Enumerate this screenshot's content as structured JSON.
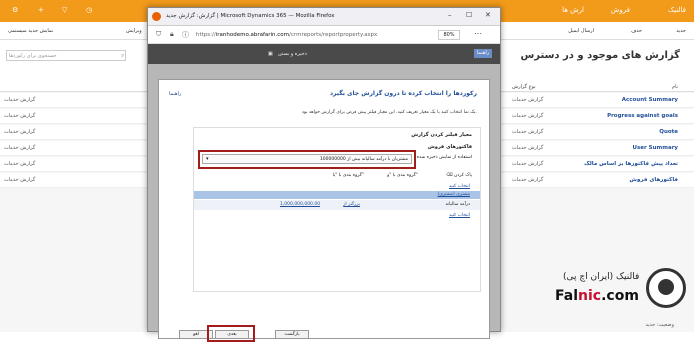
{
  "topbar": {
    "brand": "فالنیک",
    "sales": "فروش",
    "reports": "ارش ها"
  },
  "cmdbar": {
    "delete": "حذف",
    "send_email": "ارسال ایمیل",
    "new": "جدید",
    "edit": "ویرایش",
    "show_system": "نمایش جدید سیستمی"
  },
  "page": {
    "title": "گزارش های موجود و در دسترس",
    "search_placeholder": "جستجوی برای رکوردها"
  },
  "grid": {
    "col_name": "نام",
    "col_type": "نوع گزارش",
    "rows": [
      {
        "name": "Account Summary",
        "type": "گزارش خدمات"
      },
      {
        "name": "Progress against goals",
        "type": "گزارش خدمات"
      },
      {
        "name": "Quote",
        "type": "گزارش خدمات"
      },
      {
        "name": "User Summary",
        "type": "گزارش خدمات"
      },
      {
        "name": "تعداد پیش فاکتورها بر اساس مالک",
        "type": "گزارش خدمات"
      },
      {
        "name": "فاکتورهای فروش",
        "type": "گزارش خدمات"
      }
    ],
    "footer": "وضعیت: جدید"
  },
  "browser": {
    "title": "گزارش: گزارش جدید | Microsoft Dynamics 365 — Mozilla Firefox",
    "url_prefix": "https://",
    "url_domain": "iranhodemo.abrafarin.com",
    "url_path": "/crmreports/reportproperty.aspx",
    "zoom": "80%"
  },
  "crm_cmd": {
    "save_close": "ذخیره و بستن",
    "help": "راهنما"
  },
  "dialog": {
    "title": "رکوردها را انتخاب کرده تا درون گزارش جای بگیرد",
    "help": "راهنما",
    "desc": "یک نما انتخاب کنید یا یک معیار تعریف کنید. این معیار فیلتر پیش فرض برای گزارش خواهد بود.",
    "sec_filter": "معیار فیلتر کردن گزارش",
    "sec_entity": "فاکتورهای فروش",
    "use_saved": "استفاده از نمایش ذخیره شده",
    "saved_value": "مشتریان با درآمد سالیانه بیش از 100000000",
    "clear": "پاک کردن",
    "group_and": "گروه بندی با \"و\"",
    "group_or": "گروه بندی با \"یا\"",
    "select_link": "انتخاب کنید",
    "related_link": "مشتری (مشتری)",
    "row_field": "درآمد سالیانه",
    "row_op": "بزرگتر از",
    "row_value": "1,000,000,000.00",
    "select2": "انتخاب کنید",
    "btn_cancel": "لغو",
    "btn_next": "بعدی",
    "btn_back": "بازگشت"
  },
  "logo": {
    "line1": "فالنیک (ایران اچ پی)",
    "brand_a": "Fal",
    "brand_b": "nic",
    "brand_c": ".com"
  }
}
